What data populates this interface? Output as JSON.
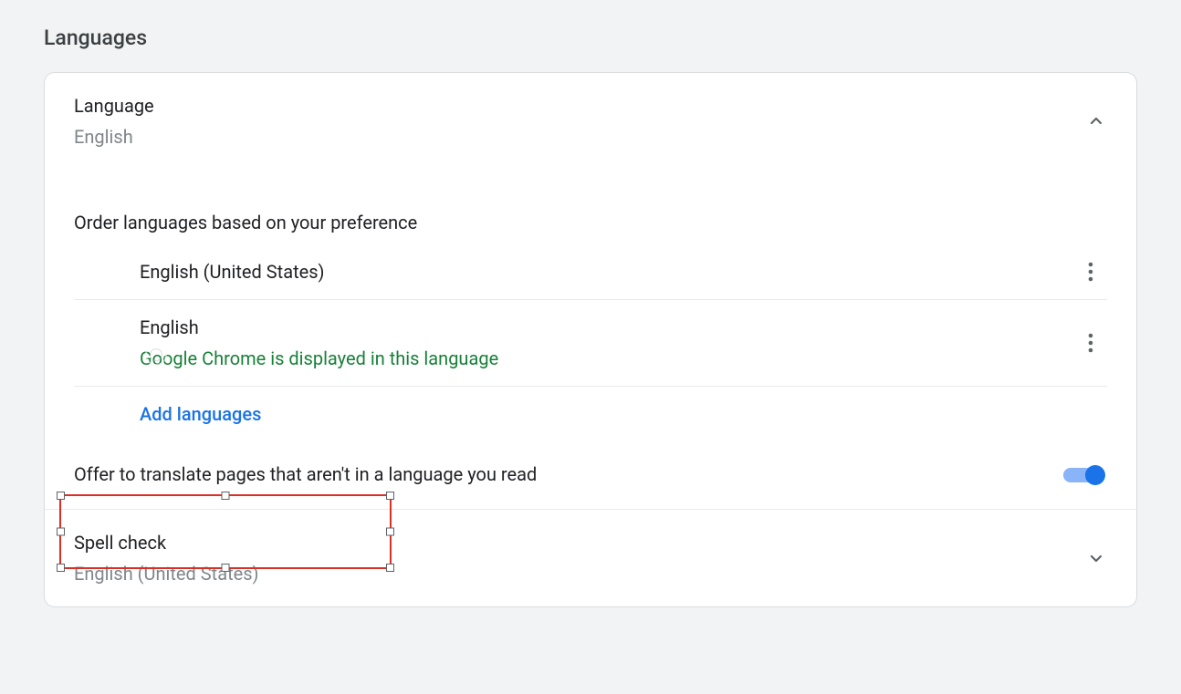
{
  "page": {
    "title": "Languages"
  },
  "language_section": {
    "title": "Language",
    "current": "English",
    "expanded": true
  },
  "order_description": "Order languages based on your preference",
  "languages": [
    {
      "name": "English (United States)",
      "note": ""
    },
    {
      "name": "English",
      "note": "Google Chrome is displayed in this language"
    }
  ],
  "add_languages_label": "Add languages",
  "translate_offer": {
    "label": "Offer to translate pages that aren't in a language you read",
    "enabled": true
  },
  "spellcheck_section": {
    "title": "Spell check",
    "current": "English (United States)",
    "expanded": false
  },
  "annotations": {
    "selection_box_around": "Add languages"
  }
}
